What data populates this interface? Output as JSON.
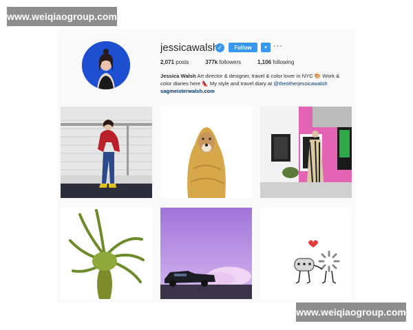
{
  "watermark": {
    "top": "www.weiqiaogroup.com",
    "bottom": "www.weiqiaogroup.com"
  },
  "profile": {
    "username": "jessicawalsh",
    "verified_icon": "✓",
    "follow_label": "Follow",
    "dropdown_icon": "▾",
    "more_icon": "···",
    "stats": {
      "posts_count": "2,071",
      "posts_label": "posts",
      "followers_count": "377k",
      "followers_label": "followers",
      "following_count": "1,106",
      "following_label": "following"
    },
    "bio": {
      "name": "Jessica Walsh",
      "text1": "Art director & designer, travel & color lover in NYC 🎨 Work & color diaries here 👠 My style and travel diary at",
      "mention": "@theotherjessicawalsh",
      "link": "sagmeisterwalsh.com"
    }
  },
  "posts": [
    {
      "icon": "photo-woman-red-jacket"
    },
    {
      "icon": "photo-dog-yellow-blanket"
    },
    {
      "icon": "photo-woman-pink-building"
    },
    {
      "icon": "photo-green-leaf-sculpture"
    },
    {
      "icon": "photo-car-purple-smoke"
    },
    {
      "icon": "illustration-chat-bubbles"
    }
  ],
  "colors": {
    "accent": "#3897f0",
    "avatar_bg": "#1f4fd1",
    "link": "#003569"
  }
}
